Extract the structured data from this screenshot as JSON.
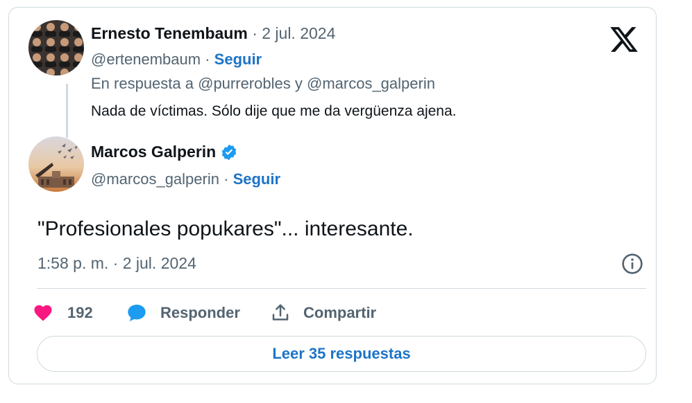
{
  "quoted_tweet": {
    "author_name": "Ernesto Tenembaum",
    "date": "· 2 jul. 2024",
    "handle": "@ertenembaum",
    "separator": "·",
    "follow_label": "Seguir",
    "in_reply_prefix": "En respuesta a",
    "in_reply_user1": "@purrerobles",
    "in_reply_join": "y",
    "in_reply_user2": "@marcos_galperin",
    "text": "Nada de víctimas. Sólo dije que me da vergüenza ajena."
  },
  "tweet": {
    "author_name": "Marcos Galperin",
    "verified": true,
    "handle": "@marcos_galperin",
    "separator": "·",
    "follow_label": "Seguir",
    "text": "\"Profesionales popukares\"... interesante.",
    "timestamp": "1:58 p. m. · 2 jul. 2024"
  },
  "actions": {
    "like_count": "192",
    "reply_label": "Responder",
    "share_label": "Compartir"
  },
  "read_replies_label": "Leer 35 respuestas",
  "icons": {
    "platform": "x-logo-icon",
    "verified": "verified-badge-icon",
    "info": "info-icon",
    "like": "heart-icon",
    "reply": "speech-bubble-icon",
    "share": "share-icon"
  },
  "colors": {
    "accent": "#1d74c7",
    "like": "#f91880",
    "reply": "#1d9bf0",
    "muted": "#536471"
  }
}
